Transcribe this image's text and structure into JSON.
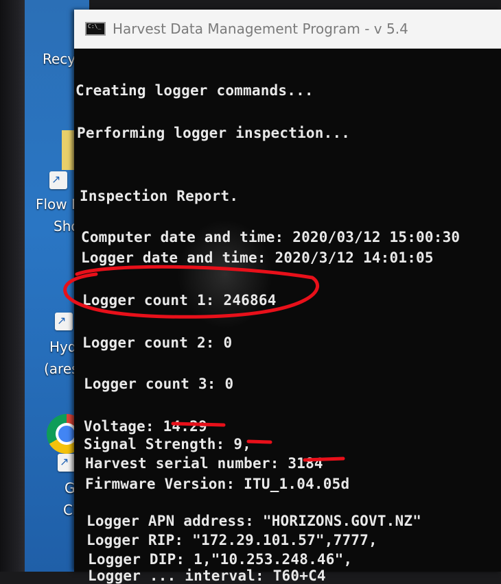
{
  "window": {
    "title": "Harvest Data Management Program - v 5.4",
    "icon": "console-window-icon",
    "icon_text": "C:\\_"
  },
  "desktop": {
    "labels": [
      "Recy",
      "Flow N",
      "Sho",
      "Hydr",
      "(ares",
      "Go",
      "Chr"
    ]
  },
  "console": {
    "lines": [
      "Creating logger commands...",
      "Performing logger inspection...",
      "Inspection Report.",
      "Computer date and time: 2020/03/12 15:00:30",
      "Logger date and time: 2020/3/12 14:01:05",
      "Logger count 1: 246864",
      "Logger count 2: 0",
      "Logger count 3: 0",
      "Voltage: 14.29",
      "Signal Strength: 9,",
      "Harvest serial number: 3184",
      "Firmware Version: ITU_1.04.05d",
      "Logger APN address: \"HORIZONS.GOVT.NZ\"",
      "Logger RIP: \"172.29.101.57\",7777,",
      "Logger DIP: 1,\"10.253.248.46\",",
      "Logger ...      interval: T60+C4"
    ]
  },
  "colors": {
    "console_bg": "#0a0a0a",
    "console_text": "#e9e9e9",
    "annotation_red": "#e8101a",
    "desktop_blue": "#2a76c4",
    "titlebar_bg": "#f4f4f4"
  }
}
